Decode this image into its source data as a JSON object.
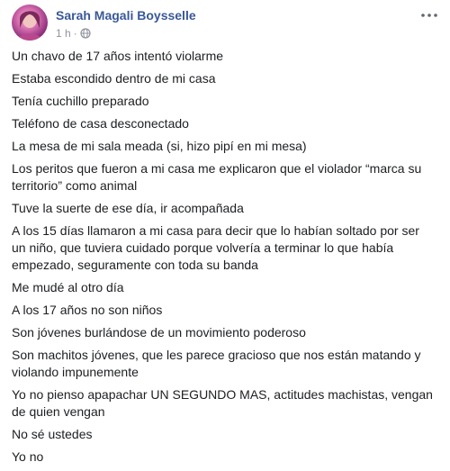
{
  "post": {
    "author": "Sarah Magali Boysselle",
    "timestamp": "1 h",
    "separator": "·",
    "privacy_icon": "globe-icon",
    "more_icon": "more-options-icon",
    "paragraphs": [
      "Un chavo de 17 años intentó violarme",
      "Estaba escondido dentro de mi casa",
      "Tenía cuchillo preparado",
      "Teléfono de casa desconectado",
      "La mesa de mi sala meada (si, hizo pipí en mi mesa)",
      "Los peritos que fueron a mi casa me explicaron que el violador “marca su territorio” como animal",
      "Tuve la suerte de ese día, ir acompañada",
      "A los 15 días llamaron a mi casa para decir que lo habían soltado por ser un niño, que tuviera cuidado porque volvería a terminar lo que había empezado, seguramente con toda su banda",
      "Me mudé al otro día",
      "A los 17 años no son niños",
      "Son jóvenes burlándose de un movimiento poderoso",
      "Son machitos jóvenes, que les parece gracioso que nos están matando y violando impunemente",
      "Yo no pienso apapachar UN SEGUNDO MAS, actitudes machistas, vengan de quien vengan",
      "No sé ustedes",
      "Yo no"
    ]
  },
  "colors": {
    "author_link": "#385898",
    "meta_text": "#90949c",
    "body_text": "#1c1e21"
  }
}
